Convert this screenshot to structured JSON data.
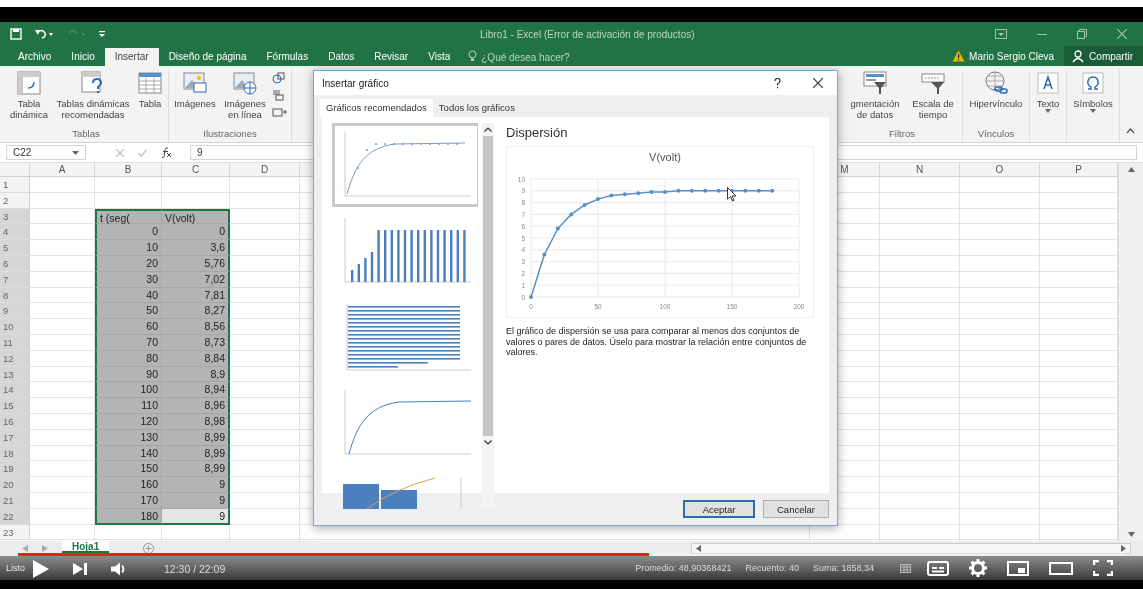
{
  "window": {
    "title": "Libro1 - Excel (Error de activación de productos)"
  },
  "ribbon_tabs": [
    {
      "label": "Archivo",
      "selected": false
    },
    {
      "label": "Inicio",
      "selected": false
    },
    {
      "label": "Insertar",
      "selected": true
    },
    {
      "label": "Diseño de página",
      "selected": false
    },
    {
      "label": "Fórmulas",
      "selected": false
    },
    {
      "label": "Datos",
      "selected": false
    },
    {
      "label": "Revisar",
      "selected": false
    },
    {
      "label": "Vista",
      "selected": false
    }
  ],
  "tell_me": {
    "placeholder": "¿Qué desea hacer?"
  },
  "account": {
    "user": "Mario Sergio Cleva",
    "share": "Compartir"
  },
  "ribbon_groups_left": [
    {
      "label": "Tablas",
      "buttons": [
        {
          "kind": "pivot",
          "label": "Tabla dinámica"
        },
        {
          "kind": "recommended_pivot",
          "label": "Tablas dinámicas recomendadas"
        },
        {
          "kind": "table",
          "label": "Tabla"
        }
      ]
    },
    {
      "label": "Ilustraciones",
      "buttons": [
        {
          "kind": "pictures",
          "label": "Imágenes"
        },
        {
          "kind": "online_pictures",
          "label": "Imágenes en línea"
        }
      ]
    }
  ],
  "ribbon_groups_right": [
    {
      "label": "Filtros",
      "buttons": [
        {
          "kind": "slicer",
          "label": "gmentación de datos"
        },
        {
          "kind": "timeline",
          "label": "Escala de tiempo"
        }
      ]
    },
    {
      "label": "Vínculos",
      "buttons": [
        {
          "kind": "hyperlink",
          "label": "Hipervínculo"
        }
      ]
    },
    {
      "buttons": [
        {
          "kind": "text",
          "label": "Texto"
        }
      ]
    },
    {
      "buttons": [
        {
          "kind": "symbols",
          "label": "Símbolos"
        }
      ]
    }
  ],
  "formula_bar": {
    "name_box": "C22",
    "value": "9"
  },
  "sheet": {
    "columns_left": [
      "A",
      "B",
      "C",
      "D"
    ],
    "columns_right": [
      "M",
      "N",
      "O",
      "P"
    ],
    "rows": [
      {
        "number": "1",
        "b": "",
        "c": "",
        "selected": false
      },
      {
        "number": "2",
        "b": "",
        "c": "",
        "selected": false
      },
      {
        "number": "3",
        "b": "t (seg(",
        "c": "V(volt)",
        "selected": true,
        "active": false
      },
      {
        "number": "4",
        "b": "0",
        "c": "0",
        "selected": true,
        "active": false
      },
      {
        "number": "5",
        "b": "10",
        "c": "3,6",
        "selected": true,
        "active": false
      },
      {
        "number": "6",
        "b": "20",
        "c": "5,76",
        "selected": true,
        "active": false
      },
      {
        "number": "7",
        "b": "30",
        "c": "7,02",
        "selected": true,
        "active": false
      },
      {
        "number": "8",
        "b": "40",
        "c": "7,81",
        "selected": true,
        "active": false
      },
      {
        "number": "9",
        "b": "50",
        "c": "8,27",
        "selected": true,
        "active": false
      },
      {
        "number": "10",
        "b": "60",
        "c": "8,56",
        "selected": true,
        "active": false
      },
      {
        "number": "11",
        "b": "70",
        "c": "8,73",
        "selected": true,
        "active": false
      },
      {
        "number": "12",
        "b": "80",
        "c": "8,84",
        "selected": true,
        "active": false
      },
      {
        "number": "13",
        "b": "90",
        "c": "8,9",
        "selected": true,
        "active": false
      },
      {
        "number": "14",
        "b": "100",
        "c": "8,94",
        "selected": true,
        "active": false
      },
      {
        "number": "15",
        "b": "110",
        "c": "8,96",
        "selected": true,
        "active": false
      },
      {
        "number": "16",
        "b": "120",
        "c": "8,98",
        "selected": true,
        "active": false
      },
      {
        "number": "17",
        "b": "130",
        "c": "8,99",
        "selected": true,
        "active": false
      },
      {
        "number": "18",
        "b": "140",
        "c": "8,99",
        "selected": true,
        "active": false
      },
      {
        "number": "19",
        "b": "150",
        "c": "8,99",
        "selected": true,
        "active": false
      },
      {
        "number": "20",
        "b": "160",
        "c": "9",
        "selected": true,
        "active": false
      },
      {
        "number": "21",
        "b": "170",
        "c": "9",
        "selected": true,
        "active": false
      },
      {
        "number": "22",
        "b": "180",
        "c": "9",
        "selected": true,
        "active": true
      },
      {
        "number": "23",
        "b": "",
        "c": "",
        "selected": false
      }
    ]
  },
  "sheet_tabs": [
    {
      "label": "Hoja1",
      "selected": true
    }
  ],
  "status_bar": {
    "mode": "Listo",
    "stats": [
      "Promedio: 48,90368421",
      "Recuento: 40",
      "Suma: 1858,34"
    ]
  },
  "dialog": {
    "title": "Insertar gráfico",
    "tabs": [
      {
        "label": "Gráficos recomendados",
        "selected": true
      },
      {
        "label": "Todos los gráficos",
        "selected": false
      }
    ],
    "thumbnails": [
      {
        "kind": "scatter",
        "selected": true
      },
      {
        "kind": "column",
        "selected": false
      },
      {
        "kind": "bar",
        "selected": false
      },
      {
        "kind": "line",
        "selected": false
      },
      {
        "kind": "histogram",
        "selected": false
      }
    ],
    "chart_name": "Dispersión",
    "chart_data": {
      "type": "line",
      "grid": true,
      "title": "V(volt)",
      "x": [
        0,
        10,
        20,
        30,
        40,
        50,
        60,
        70,
        80,
        90,
        100,
        110,
        120,
        130,
        140,
        150,
        160,
        170,
        180
      ],
      "series": [
        {
          "color": "#5b8fc7",
          "values": [
            0,
            3.6,
            5.8,
            7,
            7.8,
            8.3,
            8.6,
            8.7,
            8.8,
            8.9,
            8.9,
            9,
            9,
            9,
            9,
            9,
            9,
            9,
            9
          ]
        }
      ],
      "xlim": [
        0,
        200
      ],
      "ylim": [
        0,
        10
      ],
      "xticks": [
        0,
        50,
        100,
        150,
        200
      ],
      "yticks": [
        0,
        1,
        2,
        3,
        4,
        5,
        6,
        7,
        8,
        9,
        10
      ]
    },
    "description": "El gráfico de dispersión se usa para comparar al menos dos conjuntos de valores o pares de datos. Úselo para mostrar la relación entre conjuntos de valores.",
    "buttons": [
      {
        "label": "Aceptar",
        "kind": "primary"
      },
      {
        "label": "Cancelar",
        "kind": "normal"
      }
    ]
  },
  "video": {
    "progress": {
      "level": 0.57
    },
    "time": "12:30 / 22:09"
  }
}
